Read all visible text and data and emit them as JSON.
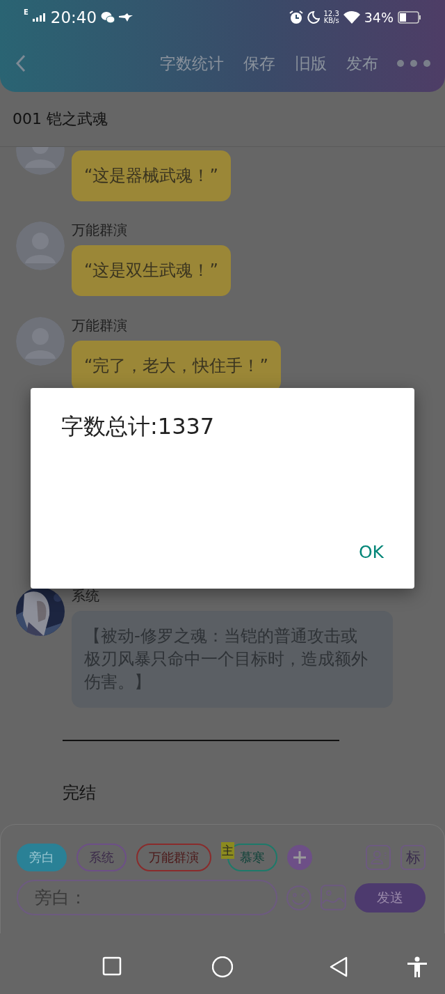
{
  "status_bar": {
    "network": "E",
    "time": "20:40",
    "speed_value": "12.3",
    "speed_unit": "KB/s",
    "battery": "34%"
  },
  "header": {
    "actions": [
      "字数统计",
      "保存",
      "旧版",
      "发布"
    ]
  },
  "chapter_title": "001 铠之武魂",
  "messages": [
    {
      "kind": "dialogue",
      "text": "“这是器械武魂！”"
    },
    {
      "kind": "dialogue",
      "sender": "万能群演",
      "text": "“这是双生武魂！”"
    },
    {
      "kind": "dialogue",
      "sender": "万能群演",
      "text": "“完了，老大，快住手！”"
    },
    {
      "kind": "system",
      "sender": "系统",
      "text": "【被动-修罗之魂：当铠的普通攻击或极刃风暴只命中一个目标时，造成额外伤害。】"
    }
  ],
  "ending": "完结",
  "composer": {
    "roles": [
      {
        "label": "旁白",
        "color": "#2a8196",
        "selected": true
      },
      {
        "label": "系统",
        "color": "#6d4f87",
        "selected": false
      },
      {
        "label": "万能群演",
        "color": "#8a2b2b",
        "selected": false
      },
      {
        "label": "慕寒",
        "color": "#1d7a6a",
        "selected": false,
        "badge": "主"
      }
    ],
    "tag_button": "标",
    "input": {
      "placeholder": "旁白："
    },
    "send": "发送"
  },
  "dialog": {
    "message": "字数总计:1337",
    "button": "OK"
  }
}
